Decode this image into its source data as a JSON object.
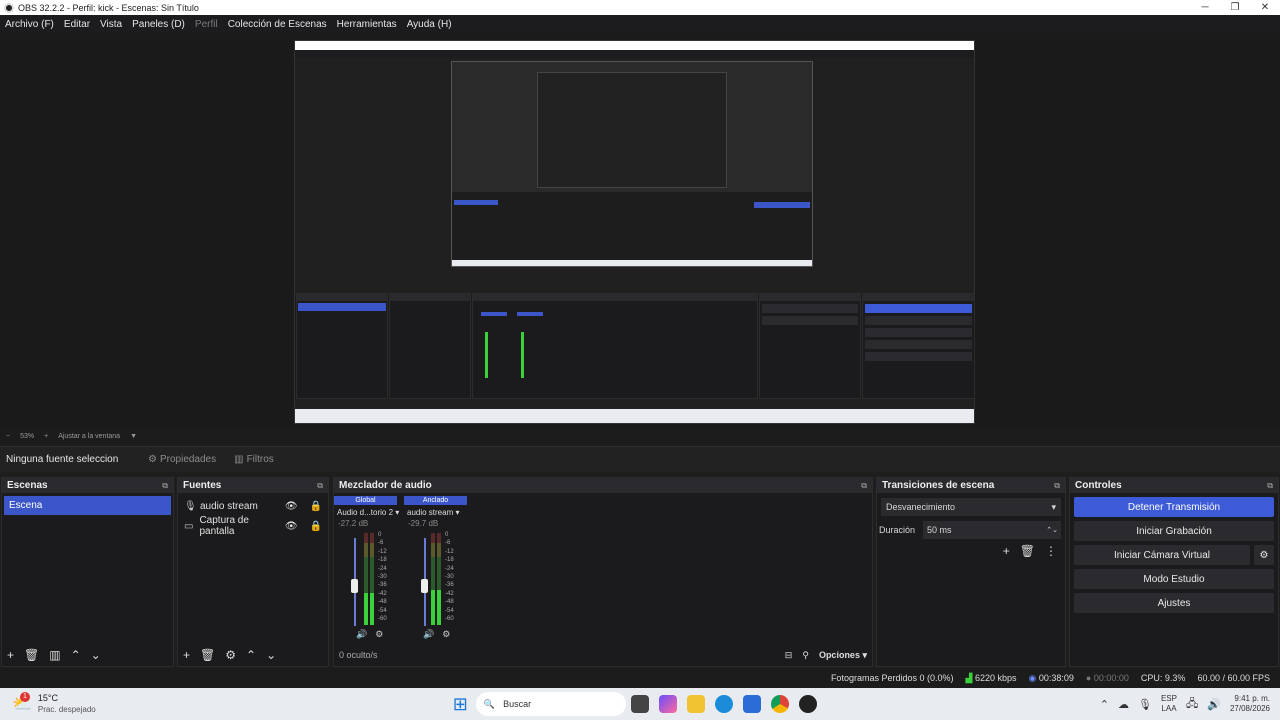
{
  "window": {
    "title": "OBS 32.2.2 - Perfil: kick - Escenas: Sin Título",
    "minimize": "─",
    "maximize": "❐",
    "close": "✕"
  },
  "menu": {
    "file": "Archivo (F)",
    "edit": "Editar",
    "view": "Vista",
    "docks": "Paneles (D)",
    "profile": "Perfil",
    "scene_collection": "Colección de Escenas",
    "tools": "Herramientas",
    "help": "Ayuda (H)"
  },
  "zoom": {
    "minus": "−",
    "value": "53%",
    "plus": "+",
    "fit": "Ajustar a la ventana",
    "dropdown": "▼"
  },
  "source_toolbar": {
    "selected": "Ninguna fuente seleccionada",
    "properties": "Propiedades",
    "filters": "Filtros"
  },
  "scenes": {
    "title": "Escenas",
    "items": [
      "Escena"
    ]
  },
  "sources": {
    "title": "Fuentes",
    "items": [
      {
        "name": "audio stream",
        "icon": "microphone-icon"
      },
      {
        "name": "Captura de pantalla",
        "icon": "monitor-icon"
      }
    ]
  },
  "mixer": {
    "title": "Mezclador de audio",
    "channels": [
      {
        "header": "Global",
        "name": "Audio d...torio 2",
        "db": "-27.2 dB",
        "level": 0.35
      },
      {
        "header": "Anclado",
        "name": "audio stream",
        "db": "-29.7 dB",
        "level": 0.38
      }
    ],
    "scale": [
      "0",
      "-6",
      "-12",
      "-18",
      "-24",
      "-30",
      "-36",
      "-42",
      "-48",
      "-54",
      "-60"
    ],
    "hidden": "0 oculto/s",
    "options": "Opciones"
  },
  "transitions": {
    "title": "Transiciones de escena",
    "selected": "Desvanecimiento",
    "duration_label": "Duración",
    "duration_value": "50 ms"
  },
  "controls": {
    "title": "Controles",
    "stop_stream": "Detener Transmisión",
    "start_recording": "Iniciar Grabación",
    "start_virtual_cam": "Iniciar Cámara Virtual",
    "studio_mode": "Modo Estudio",
    "settings": "Ajustes"
  },
  "status": {
    "dropped_frames": "Fotogramas Perdidos 0 (0.0%)",
    "bitrate": "6220 kbps",
    "stream_time": "00:38:09",
    "rec_time": "00:00:00",
    "cpu": "CPU: 9.3%",
    "fps": "60.00 / 60.00 FPS"
  },
  "taskbar": {
    "temp": "15°C",
    "weather": "Prac. despejado",
    "search": "Buscar",
    "lang_top": "ESP",
    "lang_bottom": "LAA",
    "time": "9:41 p. m.",
    "date": "27/08/2026",
    "notification_badge": "1"
  },
  "colors": {
    "accent": "#3d5bd6",
    "scene_selected": "#3a56c8",
    "meter_green": "#3ad13a"
  }
}
